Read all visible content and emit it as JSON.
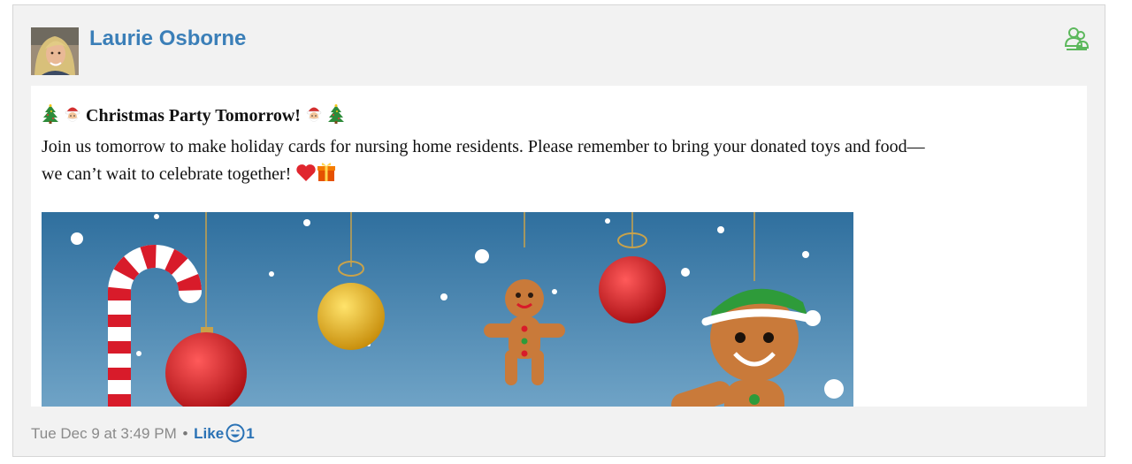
{
  "post": {
    "author": "Laurie Osborne",
    "title": "Christmas Party Tomorrow!",
    "body_line1": "Join us tomorrow to make holiday cards for nursing home residents. Please remember to bring your donated toys and food—",
    "body_line2": "we can’t wait to celebrate together!",
    "timestamp": "Tue Dec 9 at 3:49 PM",
    "separator": "•",
    "like_label": "Like",
    "reaction_count": "1"
  },
  "icons": {
    "group": "group-members-icon",
    "reaction": "smile-reaction-icon",
    "title_left": [
      "christmas-tree-icon",
      "santa-face-icon"
    ],
    "title_right": [
      "santa-face-icon",
      "christmas-tree-icon"
    ],
    "body_end": [
      "red-heart-icon",
      "gift-icon"
    ]
  },
  "colors": {
    "author": "#3b7fb8",
    "like": "#2a72b5",
    "group_icon": "#5cb85c",
    "image_sky": "#3a7aa6"
  }
}
